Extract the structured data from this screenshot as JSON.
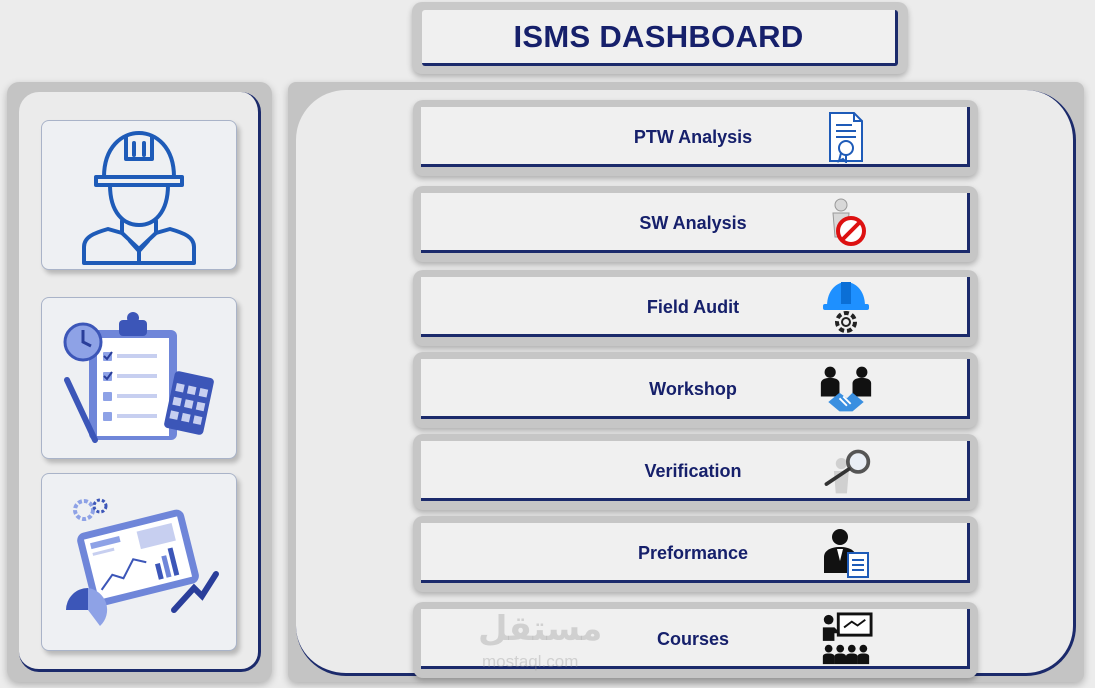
{
  "header": {
    "title": "ISMS DASHBOARD"
  },
  "sidebar": {
    "tiles": [
      {
        "icon": "engineer-helmet-icon"
      },
      {
        "icon": "clipboard-checklist-icon"
      },
      {
        "icon": "analytics-tablet-icon"
      }
    ]
  },
  "menu": {
    "items": [
      {
        "label": "PTW Analysis",
        "icon": "certificate-document-icon"
      },
      {
        "label": "SW Analysis",
        "icon": "stop-work-sign-icon"
      },
      {
        "label": "Field Audit",
        "icon": "helmet-gear-icon"
      },
      {
        "label": "Workshop",
        "icon": "handshake-people-icon"
      },
      {
        "label": "Verification",
        "icon": "magnifier-person-icon"
      },
      {
        "label": "Preformance",
        "icon": "person-report-icon"
      },
      {
        "label": "Courses",
        "icon": "classroom-board-icon"
      }
    ]
  },
  "watermark": {
    "text": "مستقل",
    "sub": "mostaql.com"
  },
  "colors": {
    "navy": "#16206b",
    "accent_blue": "#1e5bb8",
    "frame_gray": "#c4c4c4",
    "panel_bg": "#ebebeb"
  }
}
